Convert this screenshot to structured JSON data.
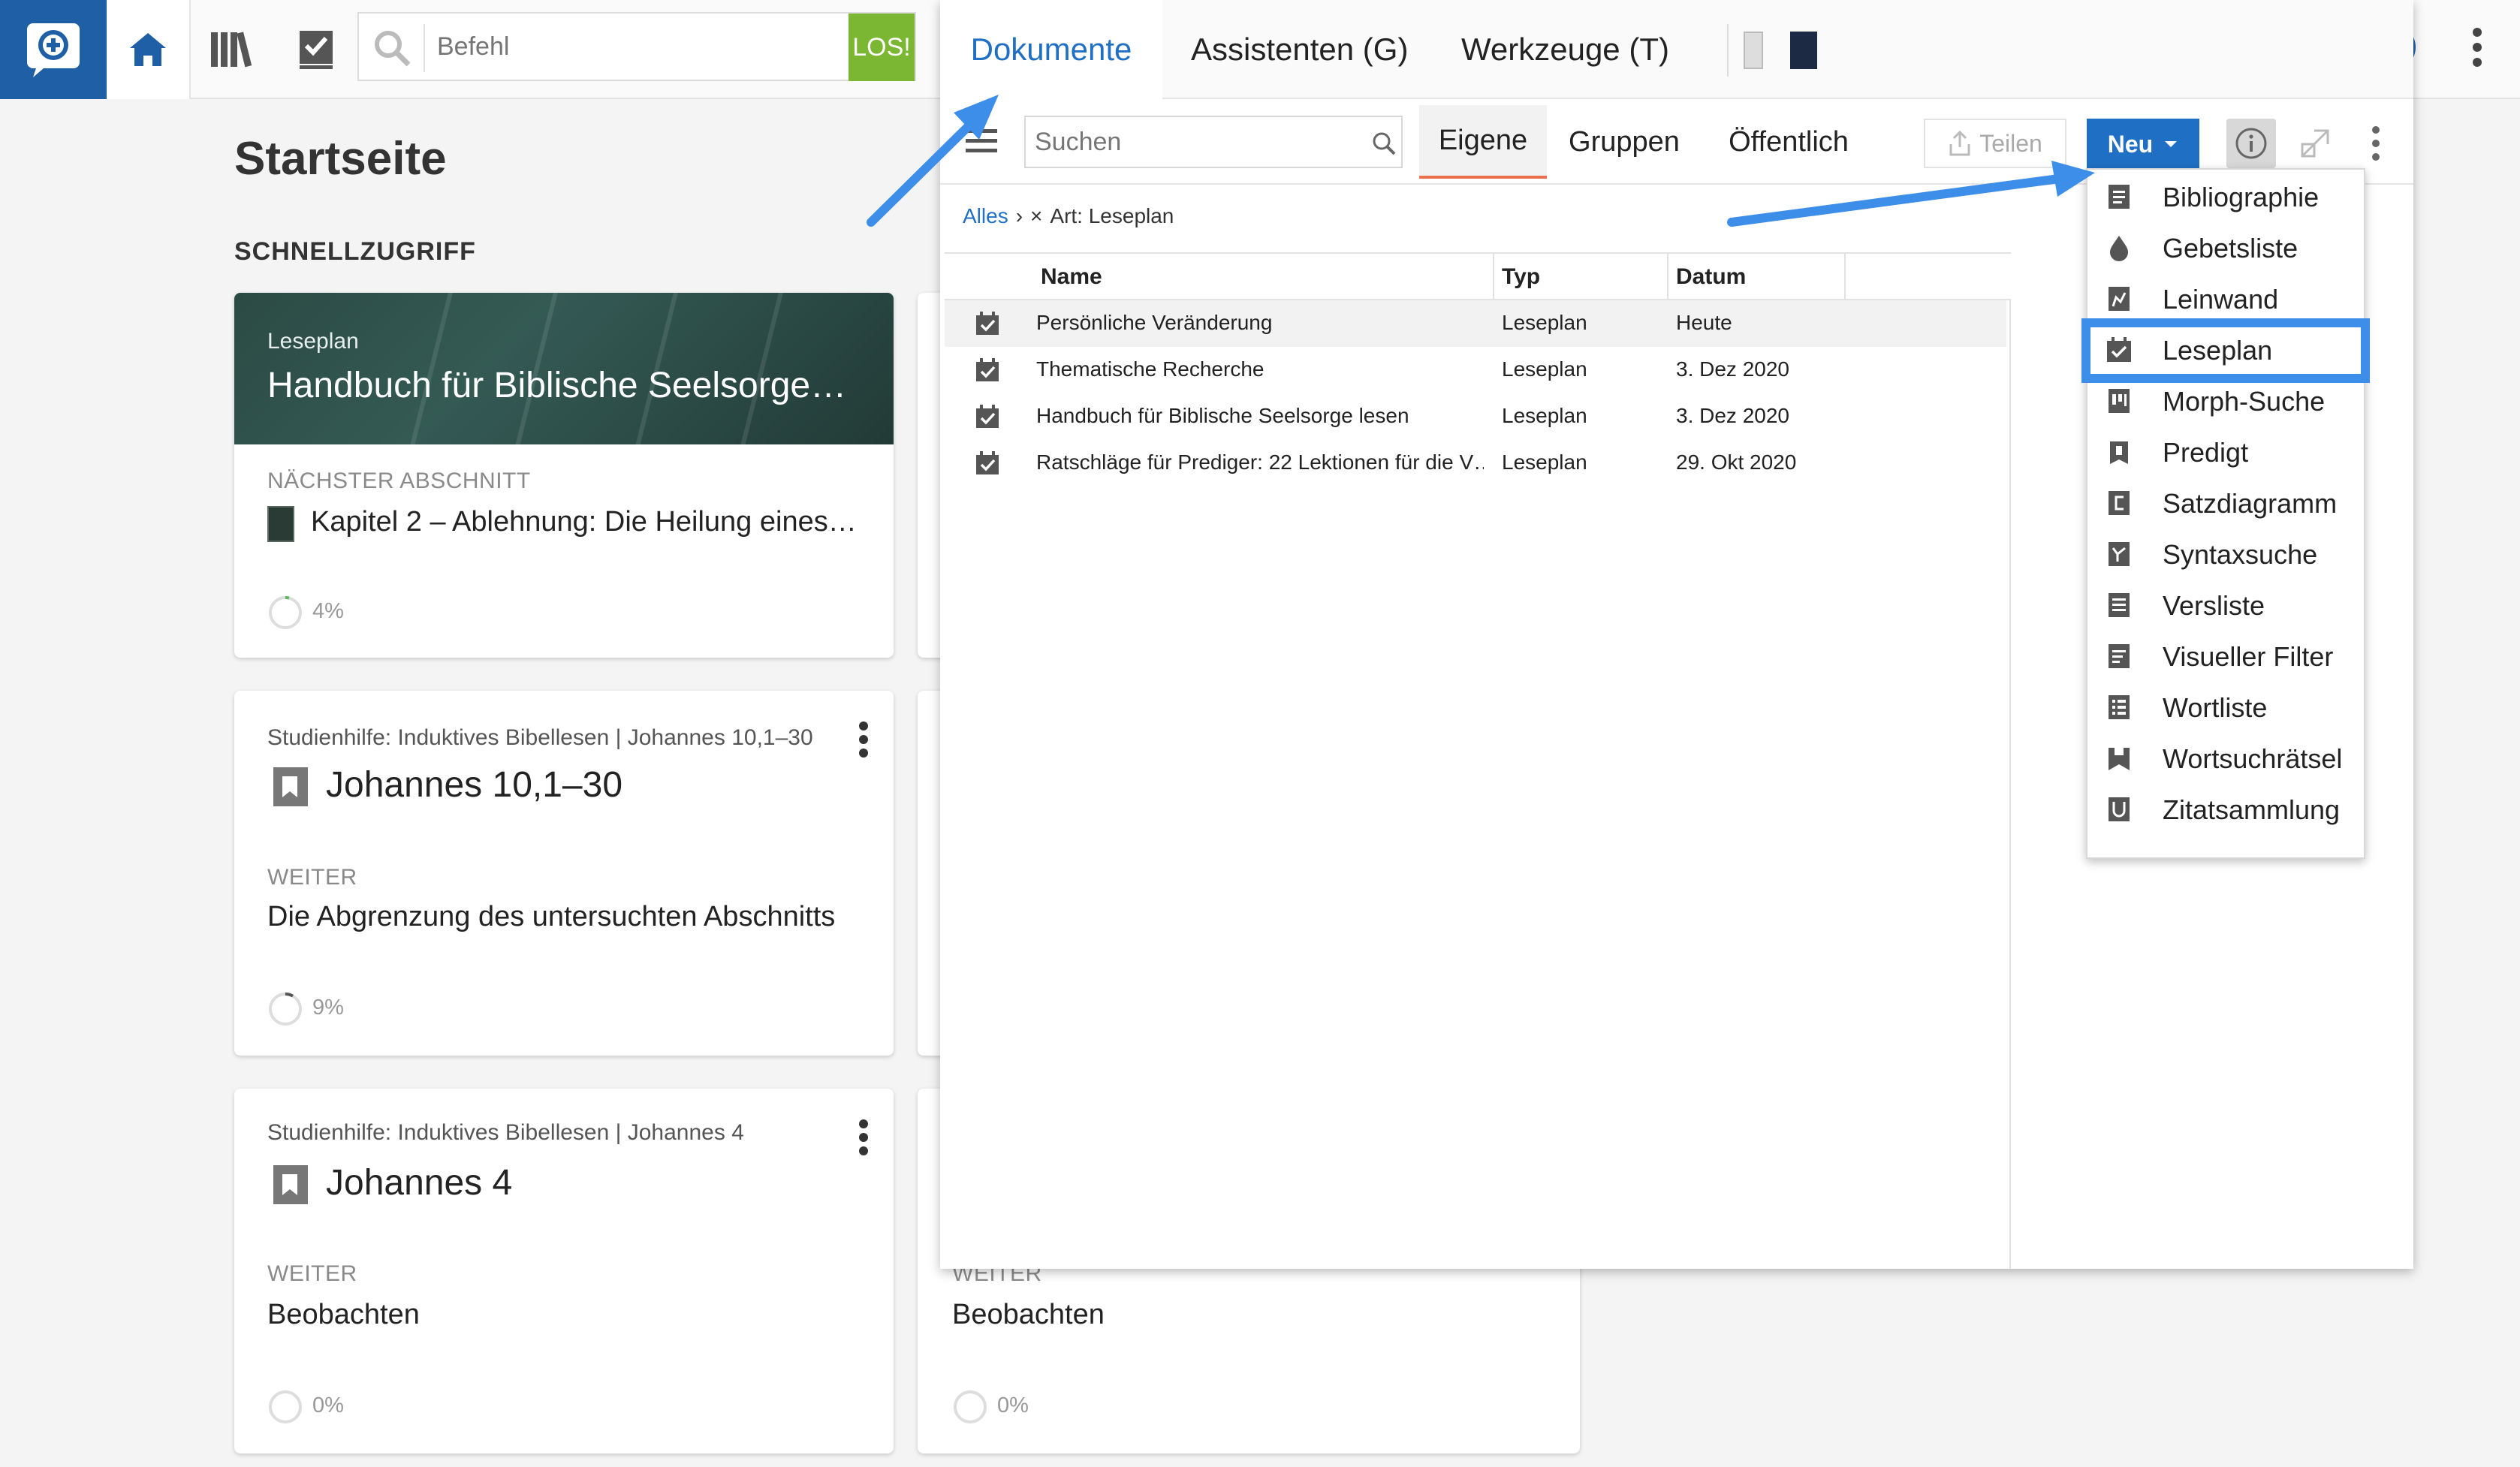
{
  "toolbar": {
    "command_placeholder": "Befehl",
    "go_label": "LOS!"
  },
  "panel": {
    "tabs": [
      "Dokumente",
      "Assistenten (G)",
      "Werkzeuge (T)"
    ],
    "search_placeholder": "Suchen",
    "filter_tabs": [
      "Eigene",
      "Gruppen",
      "Öffentlich"
    ],
    "share_label": "Teilen",
    "new_label": "Neu",
    "breadcrumb_root": "Alles",
    "breadcrumb_separator": "›",
    "breadcrumb_clear": "×",
    "breadcrumb_filter": "Art: Leseplan",
    "columns": [
      "Name",
      "Typ",
      "Datum"
    ],
    "rows": [
      {
        "name": "Persönliche Veränderung",
        "type": "Leseplan",
        "date": "Heute"
      },
      {
        "name": "Thematische Recherche",
        "type": "Leseplan",
        "date": "3. Dez 2020"
      },
      {
        "name": "Handbuch für Biblische Seelsorge lesen",
        "type": "Leseplan",
        "date": "3. Dez 2020"
      },
      {
        "name": "Ratschläge für Prediger: 22 Lektionen für die V…",
        "type": "Leseplan",
        "date": "29. Okt 2020"
      }
    ]
  },
  "new_menu": {
    "items": [
      {
        "label": "Bibliographie",
        "icon": "bibliography-icon"
      },
      {
        "label": "Gebetsliste",
        "icon": "prayer-list-icon"
      },
      {
        "label": "Leinwand",
        "icon": "canvas-icon"
      },
      {
        "label": "Leseplan",
        "icon": "reading-plan-icon"
      },
      {
        "label": "Morph-Suche",
        "icon": "morph-search-icon"
      },
      {
        "label": "Predigt",
        "icon": "sermon-icon"
      },
      {
        "label": "Satzdiagramm",
        "icon": "sentence-diagram-icon"
      },
      {
        "label": "Syntaxsuche",
        "icon": "syntax-search-icon"
      },
      {
        "label": "Versliste",
        "icon": "verse-list-icon"
      },
      {
        "label": "Visueller Filter",
        "icon": "visual-filter-icon"
      },
      {
        "label": "Wortliste",
        "icon": "word-list-icon"
      },
      {
        "label": "Wortsuchrätsel",
        "icon": "word-find-icon"
      },
      {
        "label": "Zitatsammlung",
        "icon": "quote-collection-icon"
      }
    ],
    "highlighted": "Leseplan"
  },
  "home": {
    "title": "Startseite",
    "section": "SCHNELLZUGRIFF",
    "card1": {
      "kicker": "Leseplan",
      "title": "Handbuch für Biblische Seelsorge…",
      "next_label": "NÄCHSTER ABSCHNITT",
      "next_text": "Kapitel 2 – Ablehnung: Die Heilung eines…",
      "progress": "4%"
    },
    "card2": {
      "kicker": "Studienhilfe: Induktives Bibellesen | Johannes 10,1–30",
      "title": "Johannes 10,1–30",
      "next_label": "WEITER",
      "next_text": "Die Abgrenzung des untersuchten Abschnitts",
      "progress": "9%"
    },
    "card3": {
      "kicker": "Studienhilfe: Induktives Bibellesen | Johannes 4",
      "title": "Johannes 4",
      "next_label": "WEITER",
      "next_text": "Beobachten",
      "progress": "0%"
    },
    "card4": {
      "next_label": "WEITER",
      "next_text": "Beobachten",
      "progress": "0%"
    }
  },
  "colors": {
    "brand_blue": "#1f5fa6",
    "accent_blue": "#1f6fc5",
    "go_green": "#7bb733",
    "tab_underline": "#e9704a",
    "annotation_blue": "#3d8ee8"
  }
}
